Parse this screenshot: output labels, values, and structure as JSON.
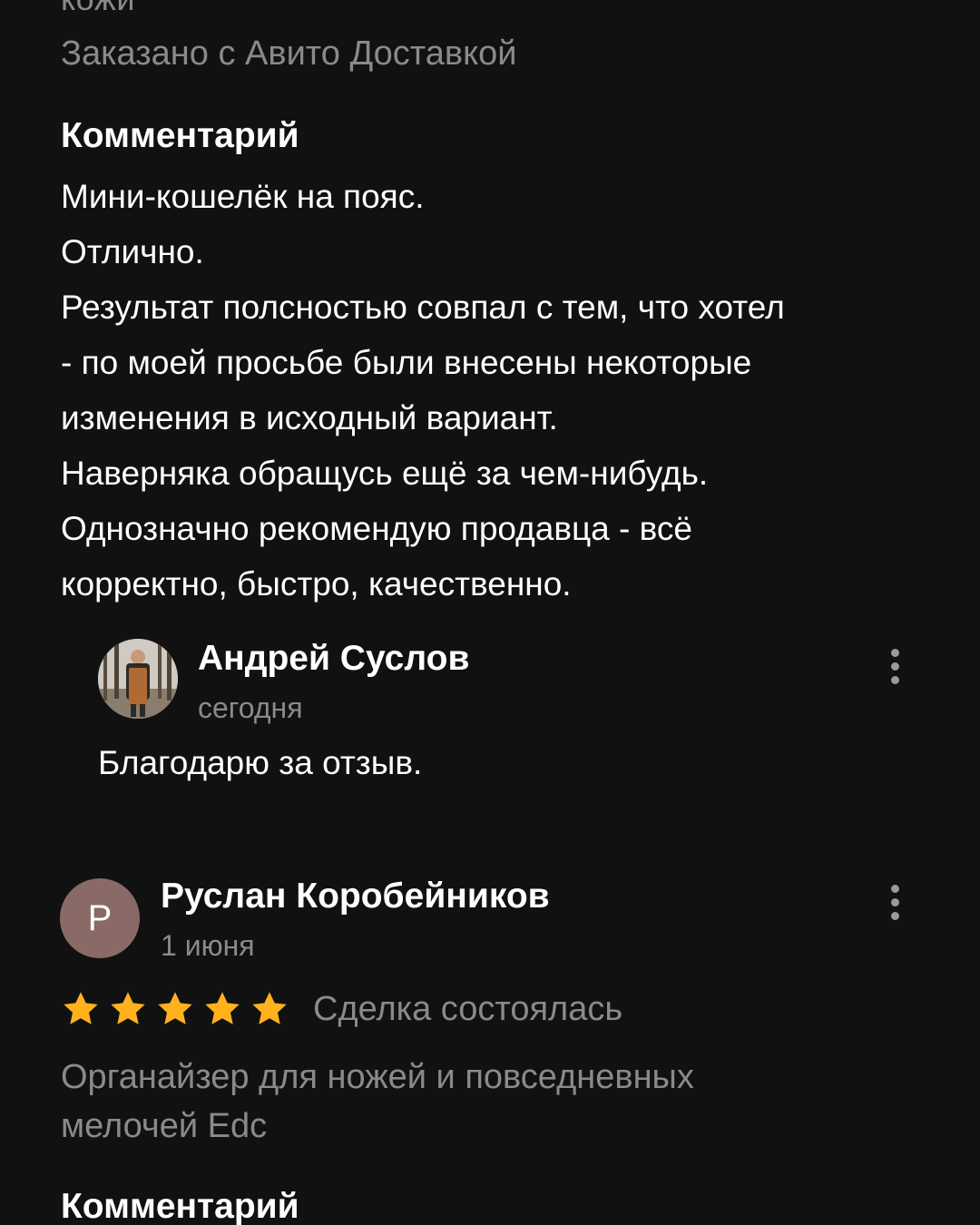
{
  "previous_review": {
    "clipped_text": "кожи",
    "ordered_via": "Заказано с Авито Доставкой",
    "comment_heading": "Комментарий",
    "comment_lines": [
      "Мини-кошелёк на пояс.",
      "Отлично.",
      "Результат полсностью совпал с тем, что хотел",
      "- по моей просьбе были внесены некоторые",
      "изменения в исходный вариант.",
      "Наверняка обращусь ещё за чем-нибудь.",
      "Однозначно рекомендую продавца - всё",
      "корректно, быстро, качественно."
    ],
    "seller_reply": {
      "name": "Андрей Суслов",
      "date": "сегодня",
      "text": "Благодарю за отзыв.",
      "avatar": "photo-avatar",
      "menu_icon": "more-vertical-icon"
    }
  },
  "review": {
    "avatar_letter": "Р",
    "avatar_color": "#8a6a66",
    "name": "Руслан Коробейников",
    "date": "1 июня",
    "rating": 5,
    "rating_max": 5,
    "star_color": "#ffb21e",
    "deal_status": "Сделка состоялась",
    "product_lines": [
      "Органайзер для ножей и повседневных",
      "мелочей Edc"
    ],
    "comment_heading": "Комментарий",
    "menu_icon": "more-vertical-icon"
  },
  "colors": {
    "background": "#111111",
    "primary_text": "#ffffff",
    "secondary_text": "#8a8a8a"
  }
}
